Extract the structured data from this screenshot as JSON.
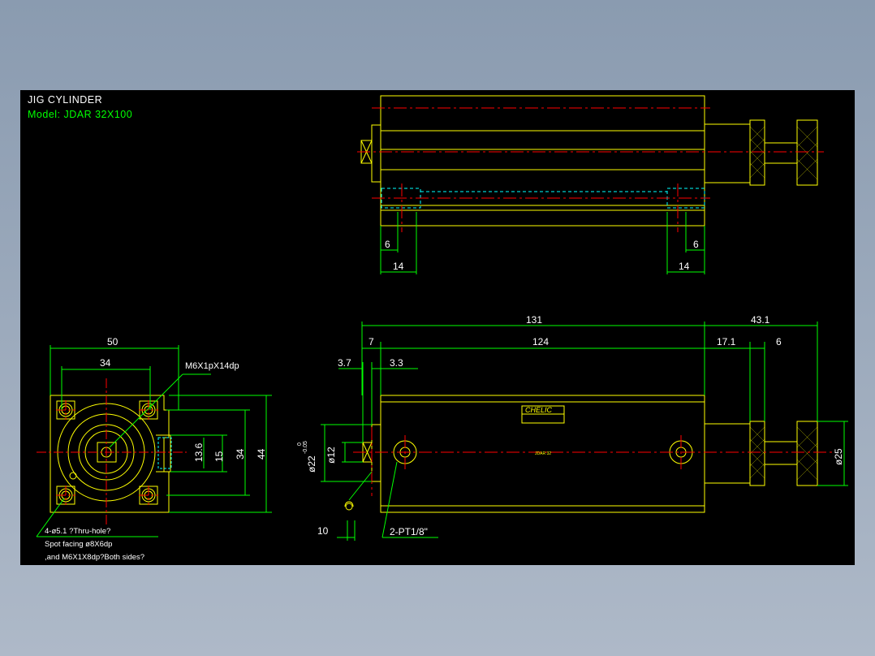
{
  "title": "JIG CYLINDER",
  "model": "Model:  JDAR  32X100",
  "colors": {
    "background": "#000000",
    "outline": "#ffff00",
    "dimension": "#00ff00",
    "centerline": "#ff0000",
    "hidden": "#00ffff",
    "white": "#ffffff"
  },
  "side_view_top": {
    "left_dims": [
      "6",
      "14"
    ],
    "right_dims": [
      "6",
      "14"
    ]
  },
  "front_view": {
    "width_outer": "50",
    "width_inner": "34",
    "thread_callout": "M6X1pX14dp",
    "heights": [
      "13.6",
      "15",
      "34",
      "44"
    ],
    "notes": [
      "4-ø5.1 ?Thru-hole?",
      "Spot facing  ø8X6dp",
      ",and M6X1X8dp?Both sides?"
    ]
  },
  "side_view_bottom": {
    "overall": "131",
    "extension": "43.1",
    "small_left": "7",
    "body": "124",
    "ext_a": "17.1",
    "ext_b": "6",
    "step_a": "3.7",
    "step_b": "3.3",
    "dia_a": "ø22",
    "dia_a_tol": "-0.05",
    "dia_a_tol0": "0",
    "dia_b": "ø12",
    "dia_c": "ø25",
    "bottom_left": "10",
    "port": "2-PT1/8\"",
    "brand": "CHELIC",
    "body_text": "JDAR 32"
  }
}
